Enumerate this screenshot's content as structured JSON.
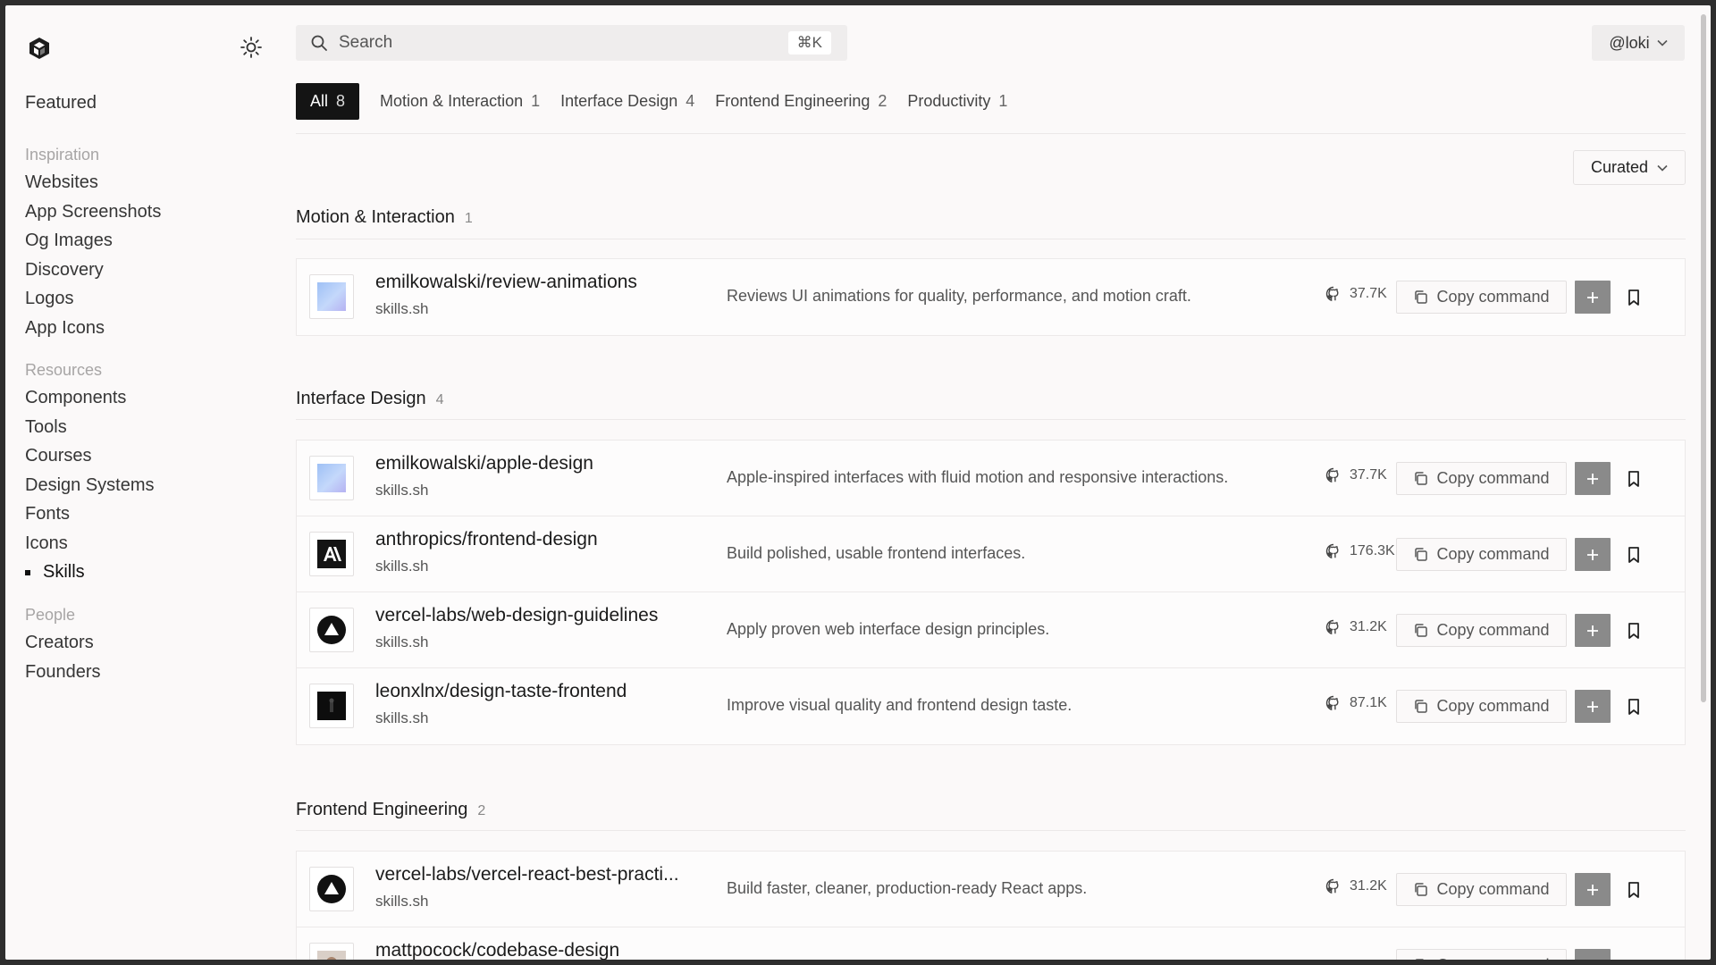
{
  "header": {
    "search_placeholder": "Search",
    "search_shortcut": "⌘K",
    "user_label": "@loki"
  },
  "sidebar": {
    "featured": "Featured",
    "sections": [
      {
        "heading": "Inspiration",
        "items": [
          {
            "label": "Websites"
          },
          {
            "label": "App Screenshots"
          },
          {
            "label": "Og Images"
          },
          {
            "label": "Discovery"
          },
          {
            "label": "Logos"
          },
          {
            "label": "App Icons"
          }
        ]
      },
      {
        "heading": "Resources",
        "items": [
          {
            "label": "Components"
          },
          {
            "label": "Tools"
          },
          {
            "label": "Courses"
          },
          {
            "label": "Design Systems"
          },
          {
            "label": "Fonts"
          },
          {
            "label": "Icons"
          },
          {
            "label": "Skills",
            "active": true
          }
        ]
      },
      {
        "heading": "People",
        "items": [
          {
            "label": "Creators"
          },
          {
            "label": "Founders"
          }
        ]
      }
    ]
  },
  "tabs": [
    {
      "label": "All",
      "count": "8",
      "active": true
    },
    {
      "label": "Motion & Interaction",
      "count": "1"
    },
    {
      "label": "Interface Design",
      "count": "4"
    },
    {
      "label": "Frontend Engineering",
      "count": "2"
    },
    {
      "label": "Productivity",
      "count": "1"
    }
  ],
  "sort_label": "Curated",
  "copy_label": "Copy command",
  "sections": [
    {
      "title": "Motion & Interaction",
      "count": "1",
      "items": [
        {
          "name": "emilkowalski/review-animations",
          "source": "skills.sh",
          "description": "Reviews UI animations for quality, performance, and motion craft.",
          "stars": "37.7K",
          "icon": "gradient-square-icon"
        }
      ]
    },
    {
      "title": "Interface Design",
      "count": "4",
      "items": [
        {
          "name": "emilkowalski/apple-design",
          "source": "skills.sh",
          "description": "Apple-inspired interfaces with fluid motion and responsive interactions.",
          "stars": "37.7K",
          "icon": "gradient-square-icon"
        },
        {
          "name": "anthropics/frontend-design",
          "source": "skills.sh",
          "description": "Build polished, usable frontend interfaces.",
          "stars": "176.3K",
          "icon": "anthropic-logo-icon"
        },
        {
          "name": "vercel-labs/web-design-guidelines",
          "source": "skills.sh",
          "description": "Apply proven web interface design principles.",
          "stars": "31.2K",
          "icon": "vercel-logo-icon"
        },
        {
          "name": "leonxlnx/design-taste-frontend",
          "source": "skills.sh",
          "description": "Improve visual quality and frontend design taste.",
          "stars": "87.1K",
          "icon": "dark-portrait-icon"
        }
      ]
    },
    {
      "title": "Frontend Engineering",
      "count": "2",
      "items": [
        {
          "name": "vercel-labs/vercel-react-best-practi...",
          "source": "skills.sh",
          "description": "Build faster, cleaner, production-ready React apps.",
          "stars": "31.2K",
          "icon": "vercel-logo-icon"
        },
        {
          "name": "mattpocock/codebase-design",
          "source": "",
          "description": "",
          "stars": "",
          "icon": "avatar-icon"
        }
      ]
    }
  ]
}
